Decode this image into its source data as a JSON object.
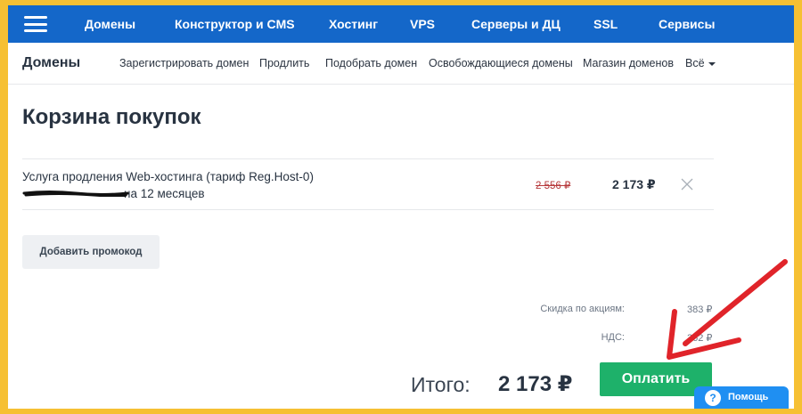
{
  "topnav": {
    "items": [
      "Домены",
      "Конструктор и CMS",
      "Хостинг",
      "VPS",
      "Серверы и ДЦ",
      "SSL",
      "Сервисы"
    ]
  },
  "subnav": {
    "title": "Домены",
    "links": [
      "Зарегистрировать домен",
      "Продлить",
      "Подобрать домен",
      "Освобождающиеся домены",
      "Магазин доменов",
      "Всё"
    ]
  },
  "cart": {
    "title": "Корзина покупок",
    "item": {
      "name_line1": "Услуга продления Web-хостинга (тариф Reg.Host-0)",
      "name_line2": "на 12 месяцев",
      "old_price": "2 556 ₽",
      "new_price": "2 173 ₽"
    },
    "promo_label": "Добавить промокод",
    "discount_label": "Скидка по акциям:",
    "discount_value": "383 ₽",
    "vat_label": "НДС:",
    "vat_value": "362 ₽",
    "total_label": "Итого:",
    "total_value": "2 173 ₽",
    "pay_label": "Оплатить"
  },
  "help": {
    "label": "Помощь",
    "icon_glyph": "?"
  },
  "colors": {
    "frame_border": "#f6c033",
    "topbar": "#1467c9",
    "pay_button": "#1eb16a",
    "arrow": "#e0242a",
    "help_button": "#1f8ff2"
  }
}
